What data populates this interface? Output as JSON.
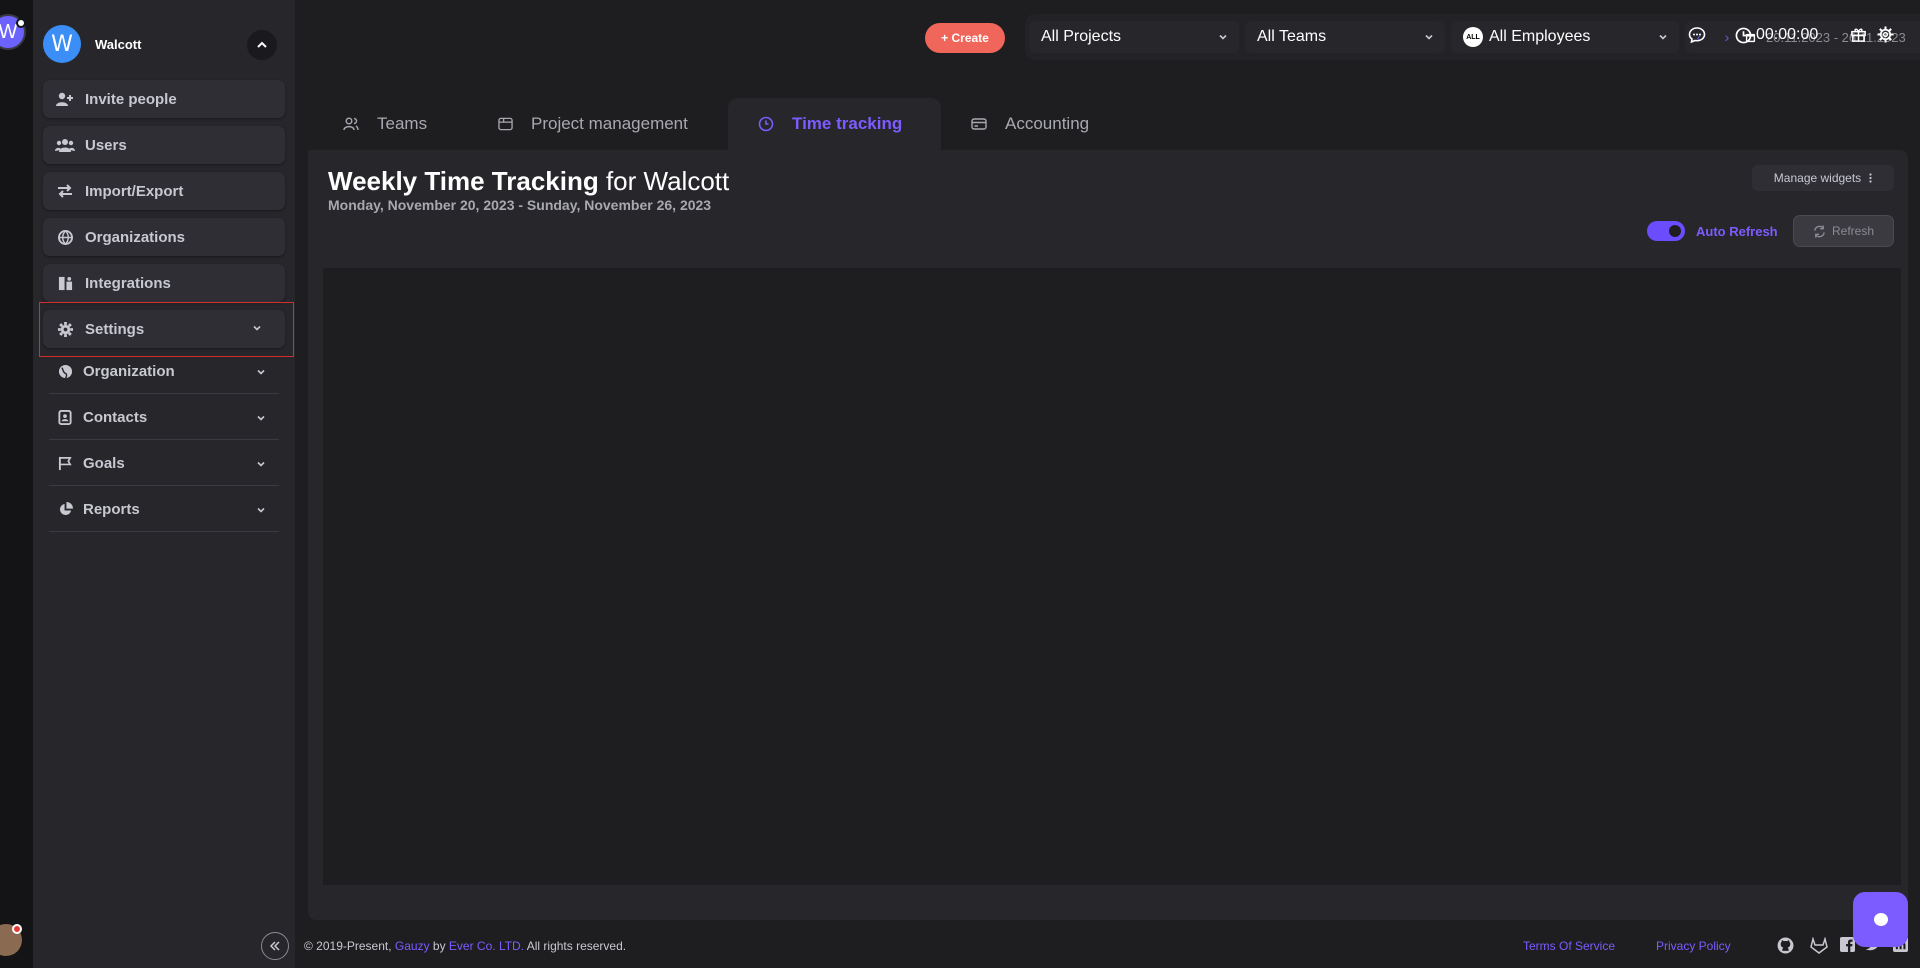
{
  "org": {
    "name": "Walcott",
    "logo_letter": "W"
  },
  "sidebar": {
    "buttons": [
      {
        "label": "Invite people",
        "icon": "user-plus-icon"
      },
      {
        "label": "Users",
        "icon": "users-icon"
      },
      {
        "label": "Import/Export",
        "icon": "swap-arrows-icon"
      },
      {
        "label": "Organizations",
        "icon": "globe-icon"
      },
      {
        "label": "Integrations",
        "icon": "puzzle-icon"
      },
      {
        "label": "Settings",
        "icon": "gear-icon"
      }
    ],
    "sub_items": [
      {
        "label": "Organization",
        "icon": "globe-solid-icon"
      },
      {
        "label": "Contacts",
        "icon": "address-book-icon"
      },
      {
        "label": "Goals",
        "icon": "flag-icon"
      },
      {
        "label": "Reports",
        "icon": "pie-chart-icon"
      }
    ]
  },
  "topbar": {
    "create_label": "+ Create",
    "projects_select": "All Projects",
    "teams_select": "All Teams",
    "employees_badge": "ALL",
    "employees_select": "All Employees",
    "date_range": "20.11.2023 - 26.11.2023",
    "timer": "00:00:00"
  },
  "tabs": [
    {
      "label": "Teams",
      "icon": "users-outline-icon"
    },
    {
      "label": "Project management",
      "icon": "board-icon"
    },
    {
      "label": "Time tracking",
      "icon": "clock-icon"
    },
    {
      "label": "Accounting",
      "icon": "card-icon"
    }
  ],
  "page": {
    "title_bold": "Weekly Time Tracking",
    "title_rest": " for Walcott",
    "subtitle": "Monday, November 20, 2023 - Sunday, November 26, 2023",
    "manage_widgets": "Manage widgets",
    "auto_refresh": "Auto Refresh",
    "refresh": "Refresh"
  },
  "footer": {
    "prefix": "© 2019-Present, ",
    "gauzy": "Gauzy",
    "by": " by ",
    "company": "Ever Co. LTD.",
    "rights": " All rights reserved.",
    "terms": "Terms Of Service",
    "privacy": "Privacy Policy"
  },
  "colors": {
    "accent": "#7c5cff",
    "create": "#f0665a",
    "highlight": "#d32f2f",
    "sidebar_bg": "#26262b",
    "page_bg": "#1e1e21"
  }
}
